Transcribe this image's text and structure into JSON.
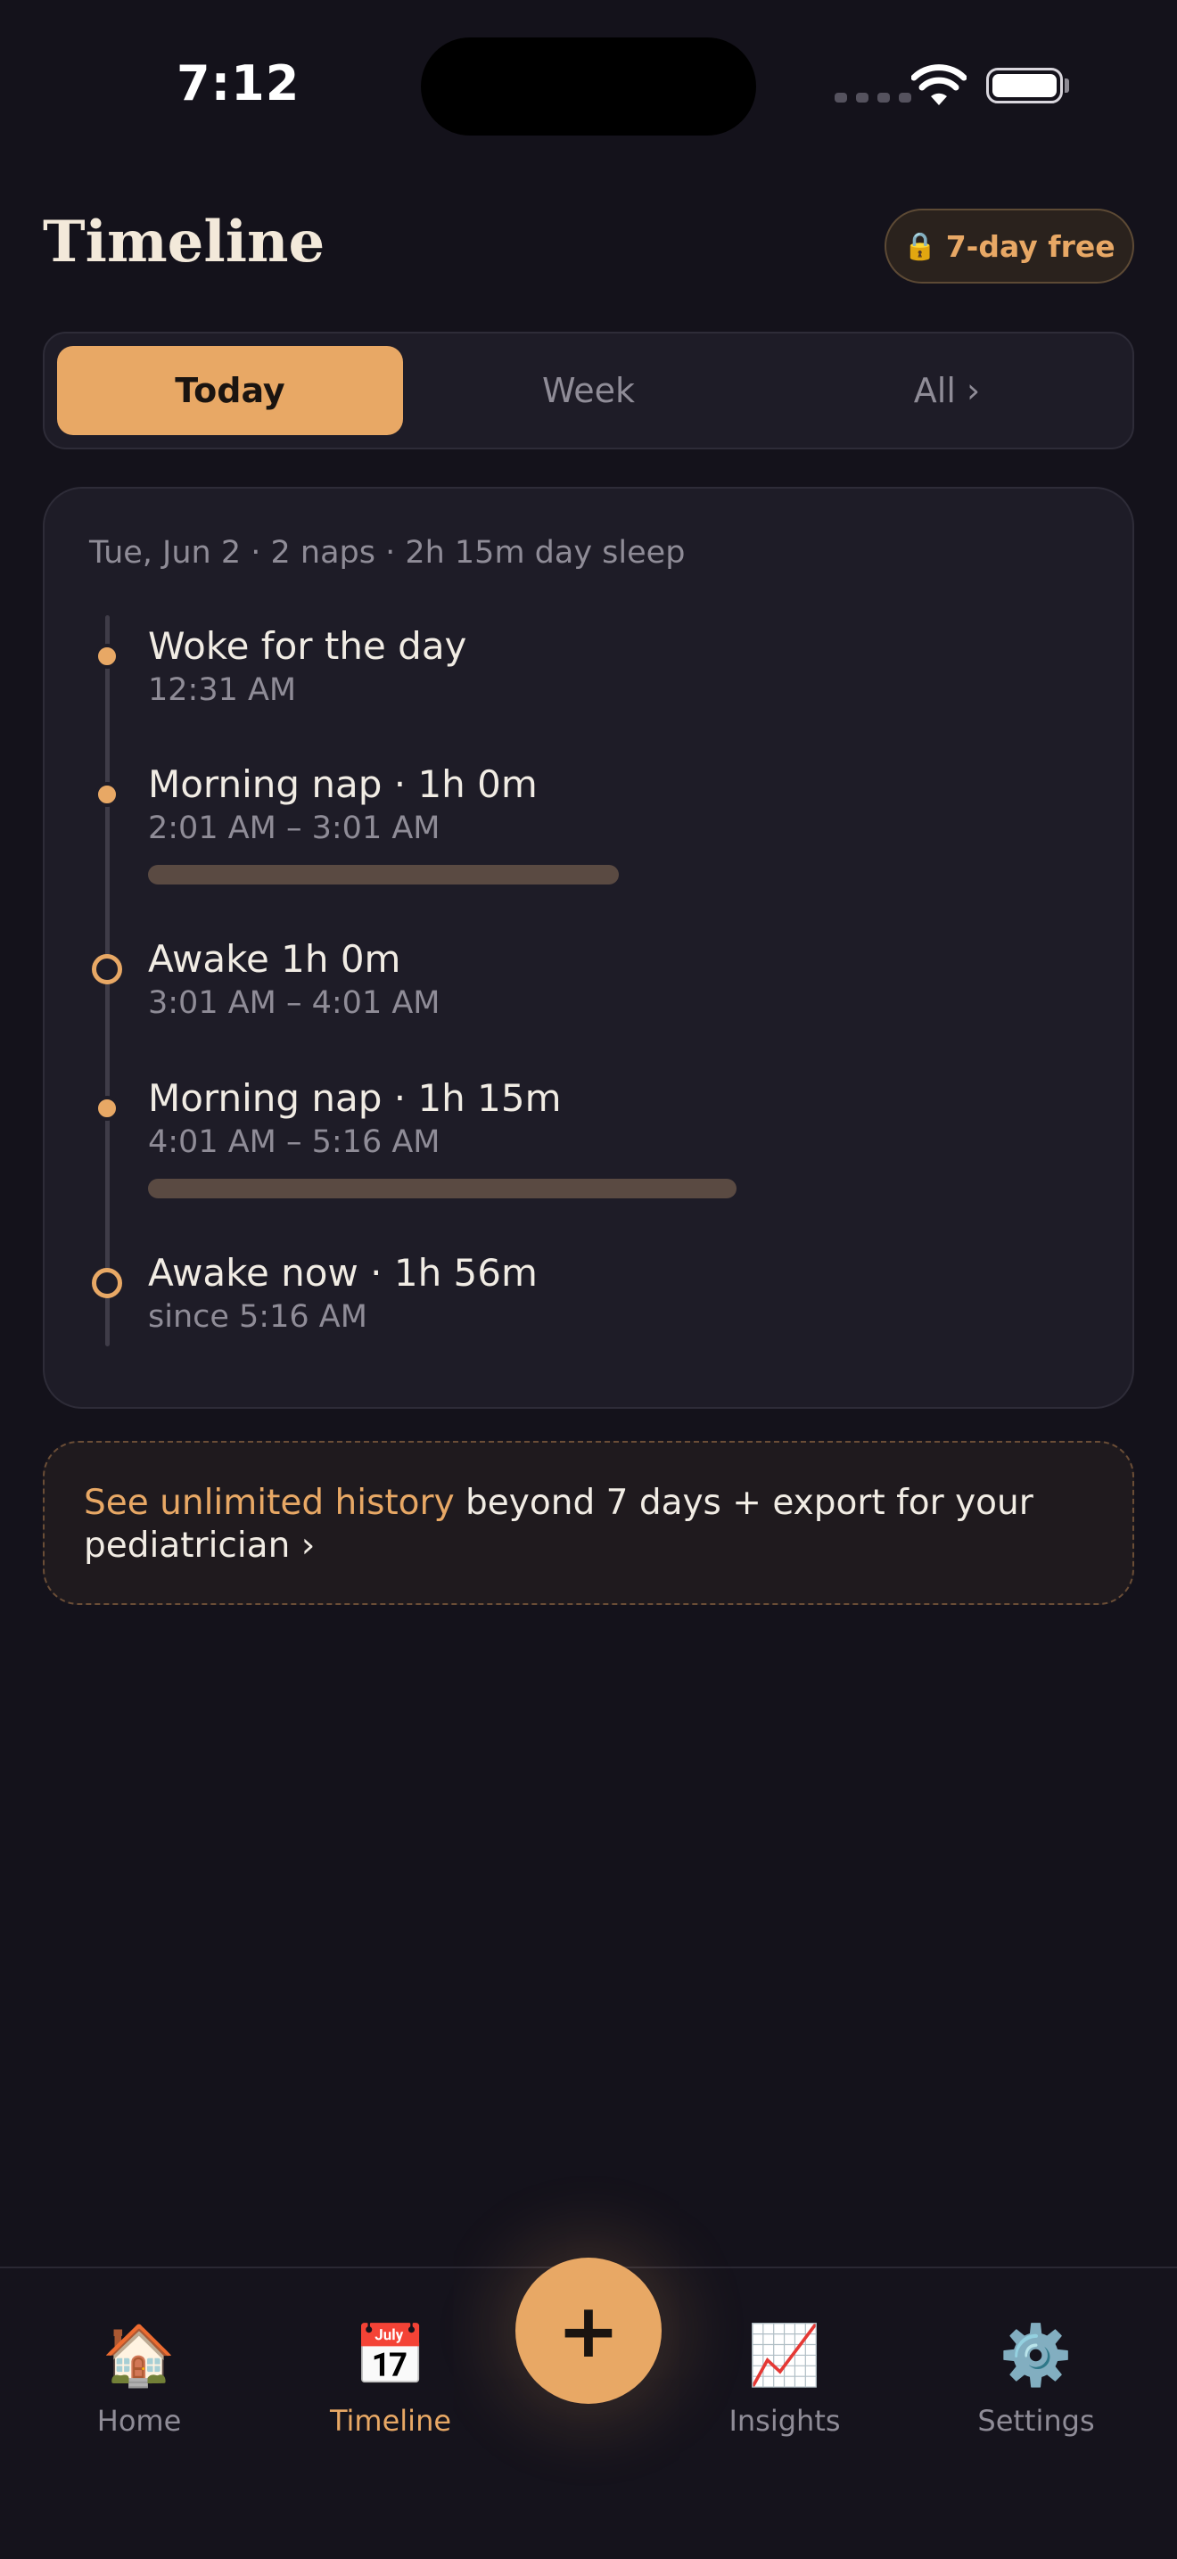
{
  "status_bar": {
    "time": "7:12"
  },
  "header": {
    "title": "Timeline",
    "trial_badge": "7-day free",
    "trial_icon": "lock-icon"
  },
  "segmented": {
    "tabs": [
      {
        "label": "Today",
        "active": true
      },
      {
        "label": "Week",
        "active": false
      },
      {
        "label": "All ›",
        "active": false
      }
    ]
  },
  "timeline": {
    "summary": "Tue, Jun 2 · 2 naps · 2h 15m day sleep",
    "entries": [
      {
        "kind": "event",
        "title": "Woke for the day",
        "sub": "12:31 AM"
      },
      {
        "kind": "nap",
        "title": "Morning nap · 1h 0m",
        "sub": "2:01 AM – 3:01 AM",
        "duration_min": 60
      },
      {
        "kind": "awake",
        "title": "Awake 1h 0m",
        "sub": "3:01 AM – 4:01 AM"
      },
      {
        "kind": "nap",
        "title": "Morning nap · 1h 15m",
        "sub": "4:01 AM – 5:16 AM",
        "duration_min": 75
      },
      {
        "kind": "awake",
        "title": "Awake now · 1h 56m",
        "sub": "since 5:16 AM"
      }
    ]
  },
  "upsell": {
    "highlight": "See unlimited history",
    "rest": " beyond 7 days + export for your pediatrician ›"
  },
  "tab_bar": {
    "items": [
      {
        "label": "Home",
        "icon": "🏠",
        "active": false
      },
      {
        "label": "Timeline",
        "icon": "📅",
        "active": true
      },
      {
        "label": "Insights",
        "icon": "📈",
        "active": false
      },
      {
        "label": "Settings",
        "icon": "⚙️",
        "active": false
      }
    ],
    "fab_label": "+"
  },
  "colors": {
    "accent": "#e8a865",
    "background": "#14121b",
    "card": "#1e1c27"
  }
}
